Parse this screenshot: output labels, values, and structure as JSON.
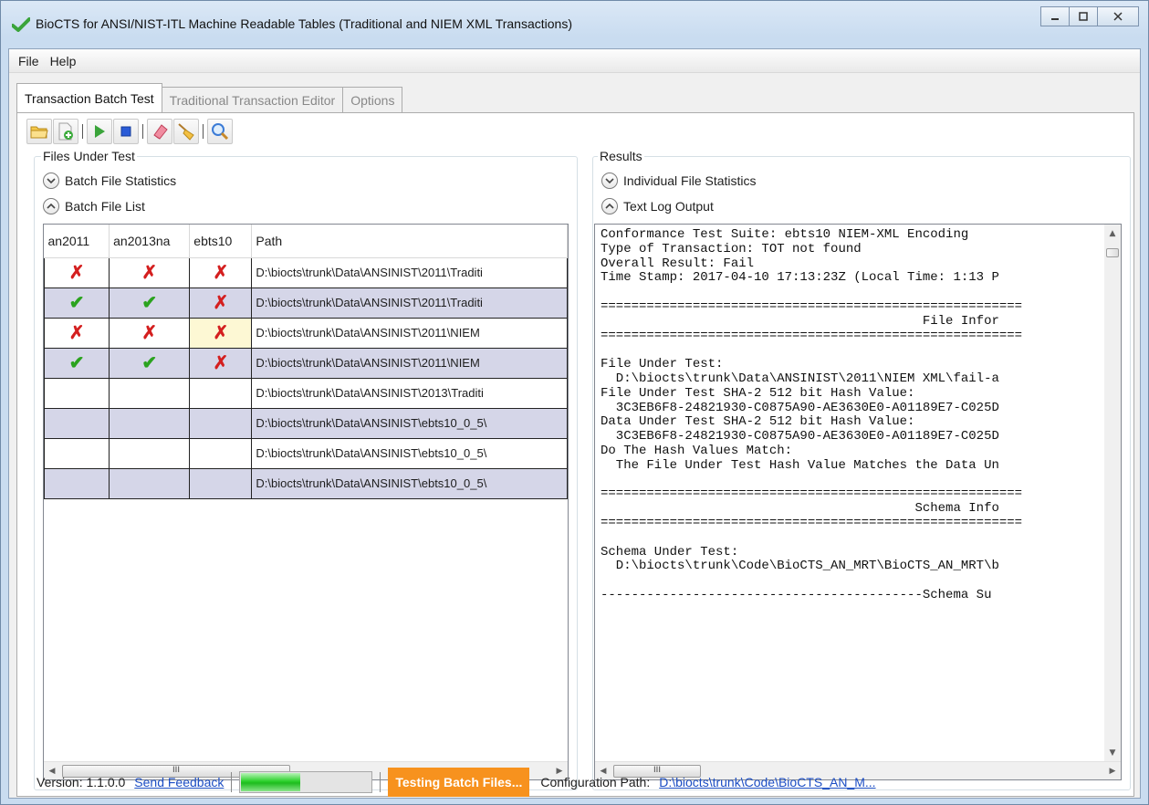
{
  "window": {
    "title": "BioCTS for ANSI/NIST-ITL Machine Readable Tables (Traditional and NIEM XML Transactions)",
    "controls": [
      "minimize",
      "maximize",
      "close"
    ]
  },
  "menu": [
    "File",
    "Help"
  ],
  "tabs": [
    {
      "label": "Transaction Batch Test",
      "active": true
    },
    {
      "label": "Traditional Transaction Editor",
      "active": false
    },
    {
      "label": "Options",
      "active": false
    }
  ],
  "toolbar": {
    "buttons": [
      "open-folder-icon",
      "add-file-icon",
      "play-icon",
      "stop-icon",
      "eraser-icon",
      "broom-icon",
      "magnifier-icon"
    ]
  },
  "files_panel": {
    "title": "Files Under Test",
    "batch_stats_label": "Batch File Statistics",
    "batch_list_label": "Batch File List",
    "columns": [
      "an2011",
      "an2013na",
      "ebts10",
      "Path"
    ],
    "rows": [
      {
        "an2011": "fail",
        "an2013na": "fail",
        "ebts10": "fail",
        "path": "D:\\biocts\\trunk\\Data\\ANSINIST\\2011\\Traditi",
        "alt": false
      },
      {
        "an2011": "pass",
        "an2013na": "pass",
        "ebts10": "fail",
        "path": "D:\\biocts\\trunk\\Data\\ANSINIST\\2011\\Traditi",
        "alt": true
      },
      {
        "an2011": "fail",
        "an2013na": "fail",
        "ebts10": "fail",
        "path": "D:\\biocts\\trunk\\Data\\ANSINIST\\2011\\NIEM",
        "alt": false,
        "highlight_ebts10": true
      },
      {
        "an2011": "pass",
        "an2013na": "pass",
        "ebts10": "fail",
        "path": "D:\\biocts\\trunk\\Data\\ANSINIST\\2011\\NIEM",
        "alt": true
      },
      {
        "an2011": "",
        "an2013na": "",
        "ebts10": "",
        "path": "D:\\biocts\\trunk\\Data\\ANSINIST\\2013\\Traditi",
        "alt": false
      },
      {
        "an2011": "",
        "an2013na": "",
        "ebts10": "",
        "path": "D:\\biocts\\trunk\\Data\\ANSINIST\\ebts10_0_5\\",
        "alt": true
      },
      {
        "an2011": "",
        "an2013na": "",
        "ebts10": "",
        "path": "D:\\biocts\\trunk\\Data\\ANSINIST\\ebts10_0_5\\",
        "alt": false
      },
      {
        "an2011": "",
        "an2013na": "",
        "ebts10": "",
        "path": "D:\\biocts\\trunk\\Data\\ANSINIST\\ebts10_0_5\\",
        "alt": true
      }
    ],
    "hscroll_grip": "III"
  },
  "results_panel": {
    "title": "Results",
    "individual_stats_label": "Individual File Statistics",
    "log_label": "Text Log Output",
    "log_lines": [
      "Conformance Test Suite: ebts10 NIEM-XML Encoding",
      "Type of Transaction: TOT not found",
      "Overall Result: Fail",
      "Time Stamp: 2017-04-10 17:13:23Z (Local Time: 1:13 P",
      "",
      "=======================================================",
      "                                          File Infor",
      "=======================================================",
      "",
      "File Under Test:",
      "  D:\\biocts\\trunk\\Data\\ANSINIST\\2011\\NIEM XML\\fail-a",
      "File Under Test SHA-2 512 bit Hash Value:",
      "  3C3EB6F8-24821930-C0875A90-AE3630E0-A01189E7-C025D",
      "Data Under Test SHA-2 512 bit Hash Value:",
      "  3C3EB6F8-24821930-C0875A90-AE3630E0-A01189E7-C025D",
      "Do The Hash Values Match:",
      "  The File Under Test Hash Value Matches the Data Un",
      "",
      "=======================================================",
      "                                         Schema Info",
      "=======================================================",
      "",
      "Schema Under Test:",
      "  D:\\biocts\\trunk\\Code\\BioCTS_AN_MRT\\BioCTS_AN_MRT\\b",
      "",
      "------------------------------------------Schema Su"
    ],
    "hscroll_grip": "III"
  },
  "status": {
    "version": "Version: 1.1.0.0",
    "feedback_link": "Send Feedback",
    "progress": 0.45,
    "testing_label": "Testing Batch Files...",
    "config_label": "Configuration Path:",
    "config_path": "D:\\biocts\\trunk\\Code\\BioCTS_AN_M..."
  },
  "colors": {
    "fail": "#d41f1f",
    "pass": "#2ba31f",
    "testing_badge": "#f7921e",
    "link": "#1c4ec4",
    "alt_row": "#d5d6e8"
  }
}
